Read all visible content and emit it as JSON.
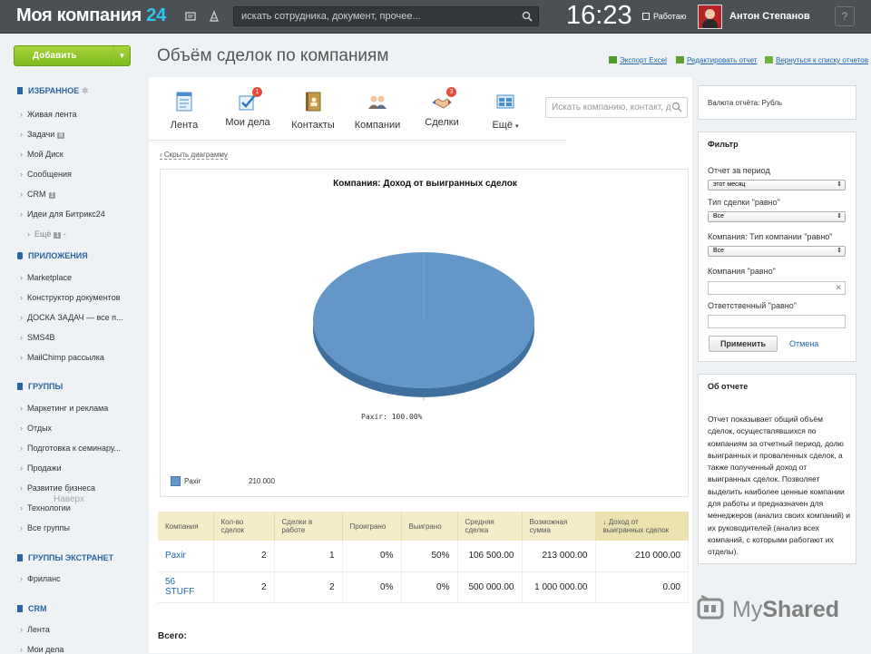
{
  "topbar": {
    "logo_main": "Моя компания",
    "logo_num": "24",
    "search_placeholder": "искать сотрудника, документ, прочее...",
    "clock": "16:23",
    "work_status": "Работаю",
    "user_name": "Антон Степанов",
    "help": "?"
  },
  "sidebar": {
    "add_button": "Добавить",
    "favorites_title": "ИЗБРАННОЕ",
    "favorites": [
      {
        "label": "Живая лента",
        "count": ""
      },
      {
        "label": "Задачи",
        "count": "8"
      },
      {
        "label": "Мой Диск",
        "count": ""
      },
      {
        "label": "Сообщения",
        "count": ""
      },
      {
        "label": "CRM",
        "count": "1"
      },
      {
        "label": "Идеи для Битрикс24",
        "count": ""
      }
    ],
    "more": "Ещё",
    "more_count": "1",
    "more_suffix": "-",
    "apps_title": "ПРИЛОЖЕНИЯ",
    "apps": [
      "Marketplace",
      "Конструктор документов",
      "ДОСКА ЗАДАЧ — все п...",
      "SMS4B",
      "MailChimp рассылка"
    ],
    "groups_title": "ГРУППЫ",
    "groups": [
      "Маркетинг и реклама",
      "Отдых",
      "Подготовка к семинару...",
      "Продажи",
      "Развитие бизнеса",
      "Технологии",
      "Все группы"
    ],
    "extranet_title": "ГРУППЫ ЭКСТРАНЕТ",
    "extranet": [
      "Фриланс"
    ],
    "crm_title": "CRM",
    "crm": [
      "Лента",
      "Мои дела"
    ],
    "naverh": "Наверх"
  },
  "page": {
    "title": "Объём сделок по компаниям",
    "export_excel": "Экспорт Excel",
    "edit_report": "Редактировать отчет",
    "back_to_list": "Вернуться к списку отчетов"
  },
  "crm_nav": {
    "items": [
      {
        "label": "Лента",
        "badge": ""
      },
      {
        "label": "Мои дела",
        "badge": "1"
      },
      {
        "label": "Контакты",
        "badge": ""
      },
      {
        "label": "Компании",
        "badge": ""
      },
      {
        "label": "Сделки",
        "badge": "3"
      },
      {
        "label": "Ещё",
        "badge": ""
      }
    ],
    "search_placeholder": "Искать компанию, контакт, д"
  },
  "report": {
    "hide_chart": "Скрыть диаграмму",
    "totals_label": "Всего:",
    "columns": [
      "Компания",
      "Кол-во сделок",
      "Сделки в работе",
      "Проиграно",
      "Выиграно",
      "Средняя сделка",
      "Возможная сумма",
      "↓ Доход от выигранных сделок"
    ],
    "rows": [
      [
        "Paxir",
        "2",
        "1",
        "0%",
        "50%",
        "106 500.00",
        "213 000.00",
        "210 000.00"
      ],
      [
        "56 STUFF",
        "2",
        "2",
        "0%",
        "0%",
        "500 000.00",
        "1 000 000.00",
        "0.00"
      ]
    ]
  },
  "chart_data": {
    "type": "pie",
    "title": "Компания: Доход от выигранных сделок",
    "slices": [
      {
        "label": "Paxir",
        "value": 210000,
        "percent": 100
      }
    ],
    "slice_label": "Paxir: 100.00%",
    "legend": [
      {
        "name": "Paxir",
        "value": "210 000"
      }
    ],
    "colors": [
      "#6496c8"
    ],
    "legend_placement": "bottom-left"
  },
  "right_panel": {
    "currency": "Валюта отчёта: Рубль",
    "filter_title": "Фильтр",
    "period_label": "Отчет за период",
    "period_value": "этот месяц",
    "deal_type_label": "Тип сделки \"равно\"",
    "deal_type_value": "Все",
    "company_type_label": "Компания: Тип компании \"равно\"",
    "company_type_value": "Все",
    "company_label": "Компания \"равно\"",
    "responsible_label": "Ответственный \"равно\"",
    "apply": "Применить",
    "cancel": "Отмена",
    "about_title": "Об отчете",
    "about_text": "Отчет показывает общий объём сделок, осуществлявшихся по компаниям за отчетный период, долю выигранных и проваленных сделок, а также полученный доход от выигранных сделок. Позволяет выделить наиболее ценные компании для работы и предназначен для менеджеров (анализ своих компаний) и их руководителей (анализ всех компаний, с которыми работают их отделы)."
  },
  "watermark": {
    "my": "My",
    "shared": "Shared"
  },
  "colors": {
    "accent": "#2067b0",
    "topbar": "#4b5055",
    "add_button": "#8cc63f",
    "table_header": "#f5edc8",
    "pie": "#6496c8"
  }
}
